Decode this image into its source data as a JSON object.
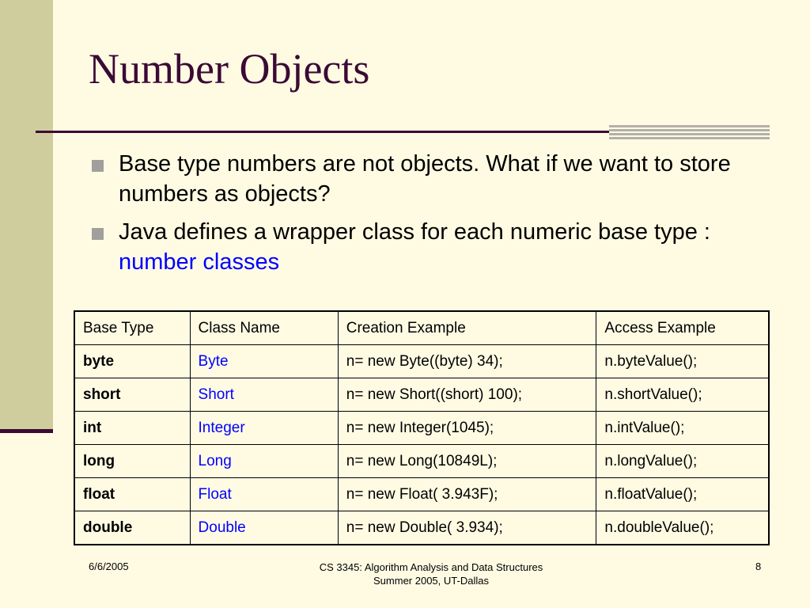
{
  "slide": {
    "title": "Number Objects",
    "bullets": [
      {
        "text": "Base type numbers are not objects. What if we want to store numbers as objects?",
        "highlight": ""
      },
      {
        "text": "Java defines a wrapper class for each numeric base type : ",
        "highlight": "number classes"
      }
    ],
    "table": {
      "headers": [
        "Base Type",
        "Class Name",
        "Creation Example",
        "Access Example"
      ],
      "rows": [
        [
          "byte",
          "Byte",
          "n= new Byte((byte) 34);",
          "n.byteValue();"
        ],
        [
          "short",
          "Short",
          "n= new Short((short) 100);",
          "n.shortValue();"
        ],
        [
          "int",
          "Integer",
          "n= new Integer(1045);",
          "n.intValue();"
        ],
        [
          "long",
          "Long",
          "n= new Long(10849L);",
          "n.longValue();"
        ],
        [
          "float",
          "Float",
          "n= new Float( 3.943F);",
          "n.floatValue();"
        ],
        [
          "double",
          "Double",
          "n= new Double( 3.934);",
          "n.doubleValue();"
        ]
      ]
    },
    "footer": {
      "date": "6/6/2005",
      "course": "CS 3345: Algorithm Analysis and Data Structures",
      "term": "Summer 2005, UT-Dallas",
      "page": "8"
    }
  },
  "colors": {
    "title": "#3b0a35",
    "background": "#fffbe3",
    "side_band": "#cfcc9e",
    "link": "#0000ff"
  }
}
